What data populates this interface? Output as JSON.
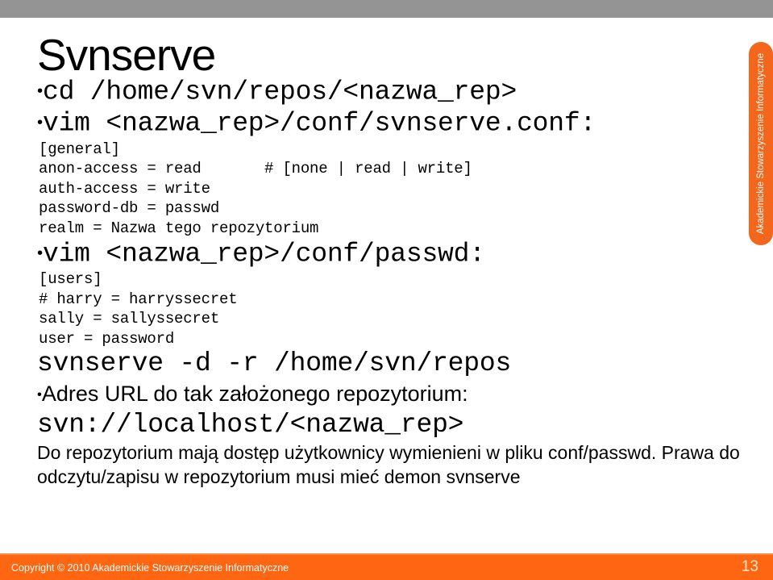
{
  "slide": {
    "title": "Svnserve",
    "page_number": "13",
    "accent_color": "#ff6611",
    "top_band_color": "#949494",
    "side_tab_color": "#f4661b",
    "side_tab_label": "Akademickie Stowarzyszenie Informatyczne",
    "copyright": "Copyright © 2010 Akademickie Stowarzyszenie Informatyczne",
    "bullet_glyph": "•"
  },
  "body": {
    "bullet_cd": "cd /home/svn/repos/<nazwa_rep>",
    "bullet_vim_conf": "vim <nazwa_rep>/conf/svnserve.conf:",
    "conf_block": [
      "[general]",
      "anon-access = read       # [none | read | write]",
      "auth-access = write",
      "password-db = passwd",
      "realm = Nazwa tego repozytorium"
    ],
    "bullet_vim_passwd": "vim <nazwa_rep>/conf/passwd:",
    "passwd_block": [
      "[users]",
      "# harry = harryssecret",
      "sally = sallyssecret",
      "user = password"
    ],
    "command_svnserve": "svnserve -d -r /home/svn/repos",
    "bullet_url": "Adres URL do tak założonego repozytorium:",
    "url_value": "svn://localhost/<nazwa_rep>",
    "note_paragraph": "Do repozytorium mają dostęp użytkownicy wymienieni w pliku conf/passwd. Prawa do odczytu/zapisu w repozytorium musi mieć demon svnserve"
  }
}
